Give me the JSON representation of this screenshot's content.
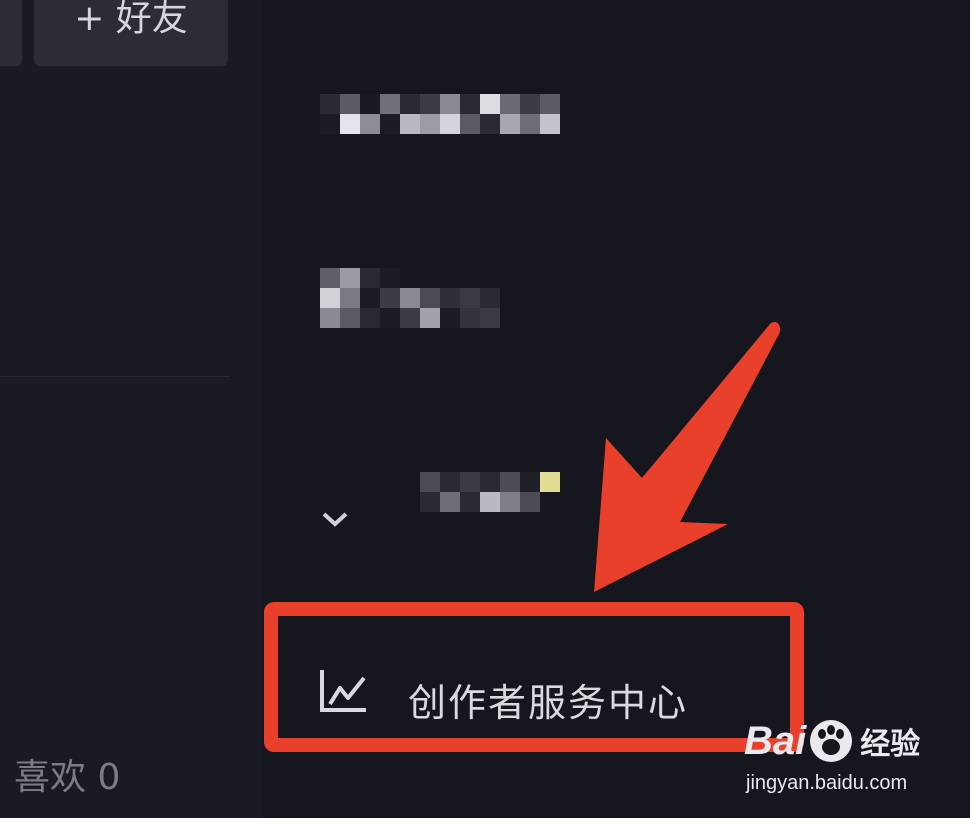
{
  "left_panel": {
    "add_friend_label": "+ 好友",
    "likes_label": "喜欢 0"
  },
  "menu": {
    "creator_center_label": "创作者服务中心",
    "creator_center_icon": "trend-chart-icon"
  },
  "annotation": {
    "arrow_color": "#e8402a",
    "highlight_color": "#e8402a"
  },
  "watermark": {
    "brand": "Bai",
    "brand_cn": "经验",
    "url": "jingyan.baidu.com"
  }
}
